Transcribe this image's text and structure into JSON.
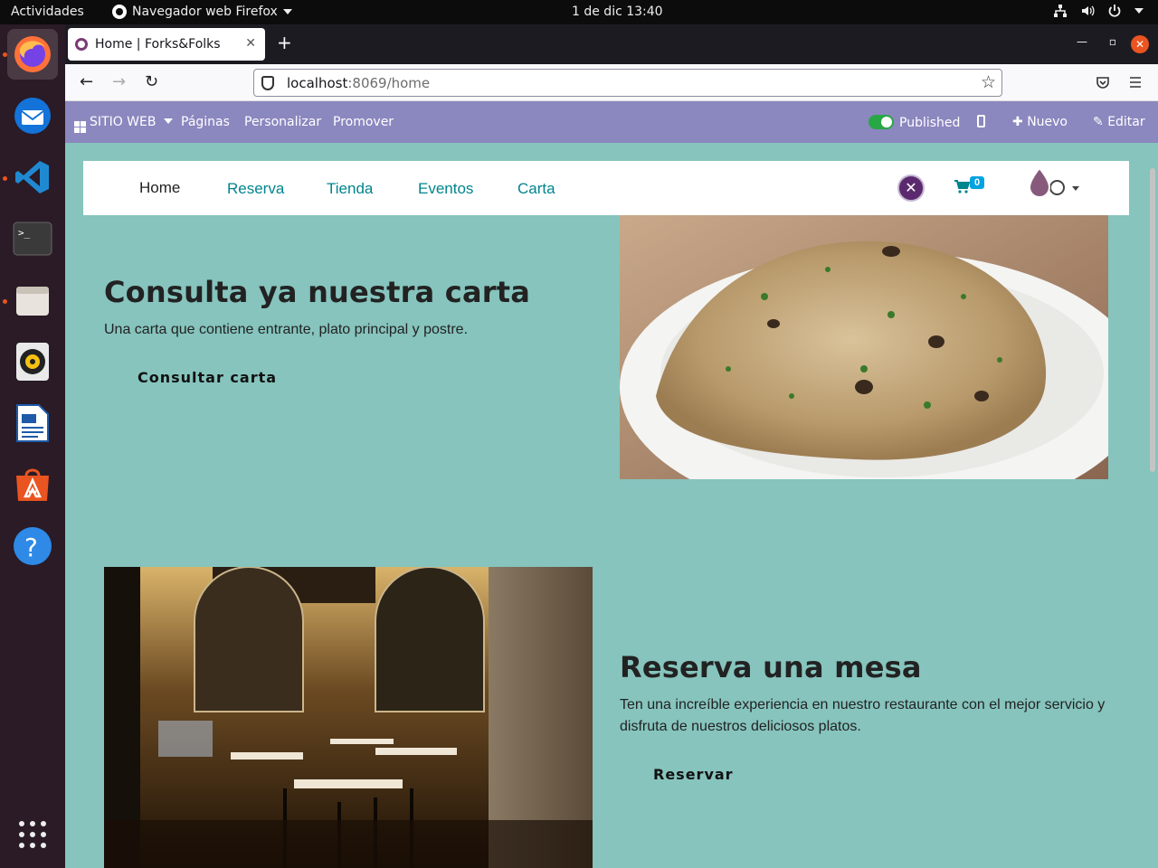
{
  "system": {
    "activities": "Actividades",
    "app_menu": "Navegador web Firefox",
    "clock": "1 de dic  13:40"
  },
  "dock": {
    "items": [
      "firefox-icon",
      "thunderbird-icon",
      "vscode-icon",
      "terminal-icon",
      "files-icon",
      "rhythmbox-icon",
      "writer-icon",
      "software-center-icon",
      "help-icon",
      "show-apps-icon"
    ]
  },
  "browser": {
    "tab_title": "Home | Forks&Folks",
    "url_host": "localhost",
    "url_path": ":8069/home"
  },
  "odoo_bar": {
    "menu": "SITIO WEB",
    "pages": "Páginas",
    "customize": "Personalizar",
    "promote": "Promover",
    "published": "Published",
    "new": "Nuevo",
    "edit": "Editar"
  },
  "site_nav": {
    "links": [
      "Home",
      "Reserva",
      "Tienda",
      "Eventos",
      "Carta"
    ],
    "cart_count": "0"
  },
  "section1": {
    "title": "Consulta ya nuestra carta",
    "text": "Una carta que contiene entrante, plato principal y postre.",
    "button": "Consultar carta"
  },
  "section2": {
    "title": "Reserva una mesa",
    "text_line1": "Ten una increíble experiencia en nuestro restaurante con el mejor servicio y",
    "text_line2": "disfruta de nuestros deliciosos platos.",
    "button": "Reservar"
  },
  "colors": {
    "page_bg": "#86c4bd",
    "odoo_bar": "#8b87bf",
    "link": "#00848e",
    "dock": "#2a1b26"
  }
}
